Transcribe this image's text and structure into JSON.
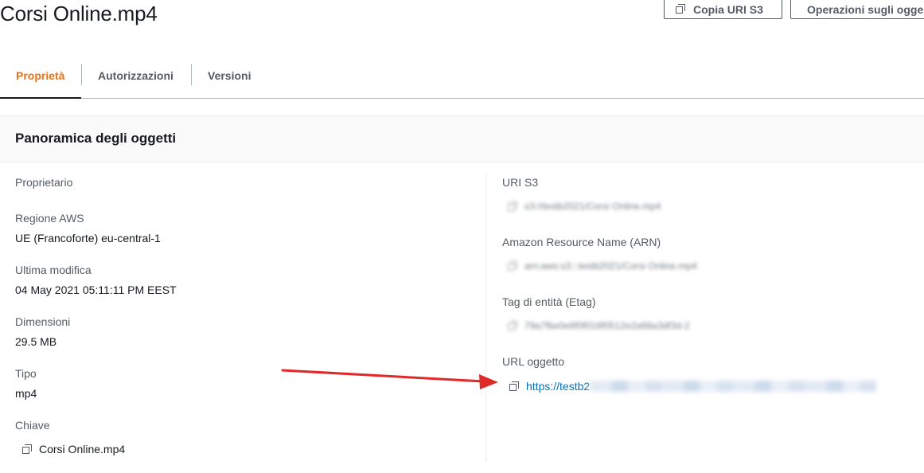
{
  "header": {
    "title": "Corsi Online.mp4",
    "copy_uri_label": "Copia URI S3",
    "operations_label": "Operazioni sugli ogge"
  },
  "tabs": [
    {
      "label": "Proprietà",
      "active": true
    },
    {
      "label": "Autorizzazioni",
      "active": false
    },
    {
      "label": "Versioni",
      "active": false
    }
  ],
  "panel": {
    "title": "Panoramica degli oggetti"
  },
  "left": {
    "owner_label": "Proprietario",
    "region_label": "Regione AWS",
    "region_value": "UE (Francoforte) eu-central-1",
    "modified_label": "Ultima modifica",
    "modified_value": "04 May 2021 05:11:11 PM EEST",
    "size_label": "Dimensioni",
    "size_value": "29.5 MB",
    "type_label": "Tipo",
    "type_value": "mp4",
    "key_label": "Chiave",
    "key_value": "Corsi Online.mp4"
  },
  "right": {
    "s3_uri_label": "URI S3",
    "s3_uri_value": "s3://testb2021/Corsi Online.mp4",
    "arn_label": "Amazon Resource Name (ARN)",
    "arn_value": "arn:aws:s3:::testb2021/Corsi Online.mp4",
    "etag_label": "Tag di entità (Etag)",
    "etag_value": "79a7fbe0e6f0f016f0512e2a68a3df3d-2",
    "url_label": "URL oggetto",
    "url_value": "https://testb2"
  },
  "colors": {
    "accent": "#ec7211",
    "link": "#0073bb",
    "annotation_arrow": "#e02a2a"
  },
  "icons": {
    "copy": "copy-icon",
    "arrow": "red-arrow-annotation"
  }
}
